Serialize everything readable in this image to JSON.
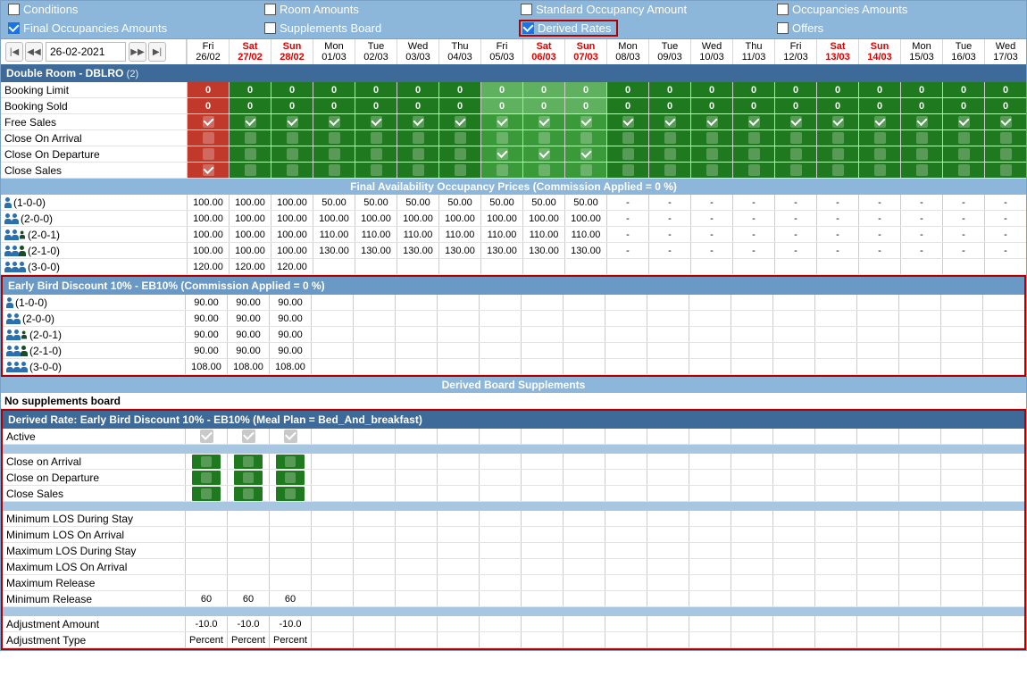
{
  "filters": {
    "row1": [
      {
        "label": "Conditions",
        "checked": false
      },
      {
        "label": "Room Amounts",
        "checked": false
      },
      {
        "label": "Standard Occupancy Amount",
        "checked": false
      },
      {
        "label": "Occupancies Amounts",
        "checked": false
      }
    ],
    "row2": [
      {
        "label": "Final Occupancies Amounts",
        "checked": true
      },
      {
        "label": "Supplements Board",
        "checked": false
      },
      {
        "label": "Derived Rates",
        "checked": true,
        "highlight": true
      },
      {
        "label": "Offers",
        "checked": false
      }
    ]
  },
  "date": "26-02-2021",
  "calendar": [
    {
      "dow": "Fri",
      "dom": "26/02",
      "weekend": false
    },
    {
      "dow": "Sat",
      "dom": "27/02",
      "weekend": true
    },
    {
      "dow": "Sun",
      "dom": "28/02",
      "weekend": true
    },
    {
      "dow": "Mon",
      "dom": "01/03",
      "weekend": false
    },
    {
      "dow": "Tue",
      "dom": "02/03",
      "weekend": false
    },
    {
      "dow": "Wed",
      "dom": "03/03",
      "weekend": false
    },
    {
      "dow": "Thu",
      "dom": "04/03",
      "weekend": false
    },
    {
      "dow": "Fri",
      "dom": "05/03",
      "weekend": false
    },
    {
      "dow": "Sat",
      "dom": "06/03",
      "weekend": true
    },
    {
      "dow": "Sun",
      "dom": "07/03",
      "weekend": true
    },
    {
      "dow": "Mon",
      "dom": "08/03",
      "weekend": false
    },
    {
      "dow": "Tue",
      "dom": "09/03",
      "weekend": false
    },
    {
      "dow": "Wed",
      "dom": "10/03",
      "weekend": false
    },
    {
      "dow": "Thu",
      "dom": "11/03",
      "weekend": false
    },
    {
      "dow": "Fri",
      "dom": "12/03",
      "weekend": false
    },
    {
      "dow": "Sat",
      "dom": "13/03",
      "weekend": true
    },
    {
      "dow": "Sun",
      "dom": "14/03",
      "weekend": true
    },
    {
      "dow": "Mon",
      "dom": "15/03",
      "weekend": false
    },
    {
      "dow": "Tue",
      "dom": "16/03",
      "weekend": false
    },
    {
      "dow": "Wed",
      "dom": "17/03",
      "weekend": false
    }
  ],
  "room_header": {
    "title": "Double Room - DBLRO",
    "count": "(2)"
  },
  "availability": {
    "booking_limit": {
      "label": "Booking Limit",
      "first": "0",
      "rest": "0",
      "light_cols": [
        7,
        8,
        9
      ]
    },
    "booking_sold": {
      "label": "Booking Sold",
      "first": "0",
      "rest": "0",
      "light_cols": [
        7,
        8,
        9
      ]
    },
    "free_sales": {
      "label": "Free Sales",
      "first_red": true,
      "checks": "all_on",
      "light_cols": [
        7,
        8,
        9
      ]
    },
    "close_arrival": {
      "label": "Close On Arrival",
      "first_red": true,
      "checks": "all_off",
      "light_cols": [
        7,
        8,
        9
      ]
    },
    "close_departure": {
      "label": "Close On Departure",
      "first_red": true,
      "checks": "mixed",
      "on_cols": [
        7,
        8,
        9
      ],
      "light_cols": [
        7,
        8,
        9
      ]
    },
    "close_sales": {
      "label": "Close Sales",
      "first_red": true,
      "first_on": true,
      "checks": "all_off",
      "light_cols": [
        7,
        8,
        9
      ]
    }
  },
  "band_final": "Final Availability Occupancy Prices (Commission Applied = 0 %)",
  "occupancies": [
    {
      "label": "(1-0-0)",
      "icons": [
        1,
        0,
        0
      ],
      "vals": [
        "100.00",
        "100.00",
        "100.00",
        "50.00",
        "50.00",
        "50.00",
        "50.00",
        "50.00",
        "50.00",
        "50.00",
        "-",
        "-",
        "-",
        "-",
        "-",
        "-",
        "-",
        "-",
        "-",
        "-"
      ]
    },
    {
      "label": "(2-0-0)",
      "icons": [
        2,
        0,
        0
      ],
      "vals": [
        "100.00",
        "100.00",
        "100.00",
        "100.00",
        "100.00",
        "100.00",
        "100.00",
        "100.00",
        "100.00",
        "100.00",
        "-",
        "-",
        "-",
        "-",
        "-",
        "-",
        "-",
        "-",
        "-",
        "-"
      ]
    },
    {
      "label": "(2-0-1)",
      "icons": [
        2,
        0,
        1
      ],
      "vals": [
        "100.00",
        "100.00",
        "100.00",
        "110.00",
        "110.00",
        "110.00",
        "110.00",
        "110.00",
        "110.00",
        "110.00",
        "-",
        "-",
        "-",
        "-",
        "-",
        "-",
        "-",
        "-",
        "-",
        "-"
      ]
    },
    {
      "label": "(2-1-0)",
      "icons": [
        2,
        1,
        0
      ],
      "vals": [
        "100.00",
        "100.00",
        "100.00",
        "130.00",
        "130.00",
        "130.00",
        "130.00",
        "130.00",
        "130.00",
        "130.00",
        "-",
        "-",
        "-",
        "-",
        "-",
        "-",
        "-",
        "-",
        "-",
        "-"
      ]
    },
    {
      "label": "(3-0-0)",
      "icons": [
        3,
        0,
        0
      ],
      "vals": [
        "120.00",
        "120.00",
        "120.00",
        "",
        "",
        "",
        "",
        "",
        "",
        "",
        "",
        "",
        "",
        "",
        "",
        "",
        "",
        "",
        "",
        ""
      ]
    }
  ],
  "eb_header": "Early Bird Discount 10% - EB10% (Commission Applied = 0 %)",
  "eb_rows": [
    {
      "label": "(1-0-0)",
      "icons": [
        1,
        0,
        0
      ],
      "vals": [
        "90.00",
        "90.00",
        "90.00"
      ]
    },
    {
      "label": "(2-0-0)",
      "icons": [
        2,
        0,
        0
      ],
      "vals": [
        "90.00",
        "90.00",
        "90.00"
      ]
    },
    {
      "label": "(2-0-1)",
      "icons": [
        2,
        0,
        1
      ],
      "vals": [
        "90.00",
        "90.00",
        "90.00"
      ]
    },
    {
      "label": "(2-1-0)",
      "icons": [
        2,
        1,
        0
      ],
      "vals": [
        "90.00",
        "90.00",
        "90.00"
      ]
    },
    {
      "label": "(3-0-0)",
      "icons": [
        3,
        0,
        0
      ],
      "vals": [
        "108.00",
        "108.00",
        "108.00"
      ]
    }
  ],
  "band_derived": "Derived Board Supplements",
  "no_supp": "No supplements board",
  "derived_header": "Derived Rate: Early Bird Discount 10% - EB10% (Meal Plan = Bed_And_breakfast)",
  "derived": {
    "active": {
      "label": "Active"
    },
    "close_arrival": {
      "label": "Close on Arrival"
    },
    "close_departure": {
      "label": "Close on Departure"
    },
    "close_sales": {
      "label": "Close Sales"
    },
    "min_los_stay": {
      "label": "Minimum LOS During Stay"
    },
    "min_los_arr": {
      "label": "Minimum LOS On Arrival"
    },
    "max_los_stay": {
      "label": "Maximum LOS During Stay"
    },
    "max_los_arr": {
      "label": "Maximum LOS On Arrival"
    },
    "max_release": {
      "label": "Maximum Release"
    },
    "min_release": {
      "label": "Minimum Release",
      "vals": [
        "60",
        "60",
        "60"
      ]
    },
    "adj_amount": {
      "label": "Adjustment Amount",
      "vals": [
        "-10.0",
        "-10.0",
        "-10.0"
      ]
    },
    "adj_type": {
      "label": "Adjustment Type",
      "vals": [
        "Percent",
        "Percent",
        "Percent"
      ]
    }
  }
}
